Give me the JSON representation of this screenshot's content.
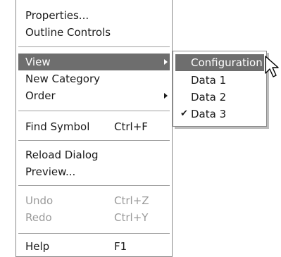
{
  "main_menu": {
    "items": [
      {
        "label": "Properties..."
      },
      {
        "label": "Outline Controls"
      },
      {
        "label": "View"
      },
      {
        "label": "New Category"
      },
      {
        "label": "Order"
      },
      {
        "label": "Find Symbol",
        "shortcut": "Ctrl+F"
      },
      {
        "label": "Reload Dialog"
      },
      {
        "label": "Preview..."
      },
      {
        "label": "Undo",
        "shortcut": "Ctrl+Z"
      },
      {
        "label": "Redo",
        "shortcut": "Ctrl+Y"
      },
      {
        "label": "Help",
        "shortcut": "F1"
      }
    ]
  },
  "submenu": {
    "items": [
      {
        "label": "Configuration"
      },
      {
        "label": "Data 1"
      },
      {
        "label": "Data 2"
      },
      {
        "label": "Data 3",
        "checked": true
      }
    ]
  },
  "colors": {
    "highlight": "#6e6e6e",
    "disabled_text": "#9a9a9a"
  },
  "icons": {
    "submenu_indicator": "triangle-right-icon",
    "checkmark": "checkmark-icon",
    "cursor": "mouse-pointer-icon"
  }
}
